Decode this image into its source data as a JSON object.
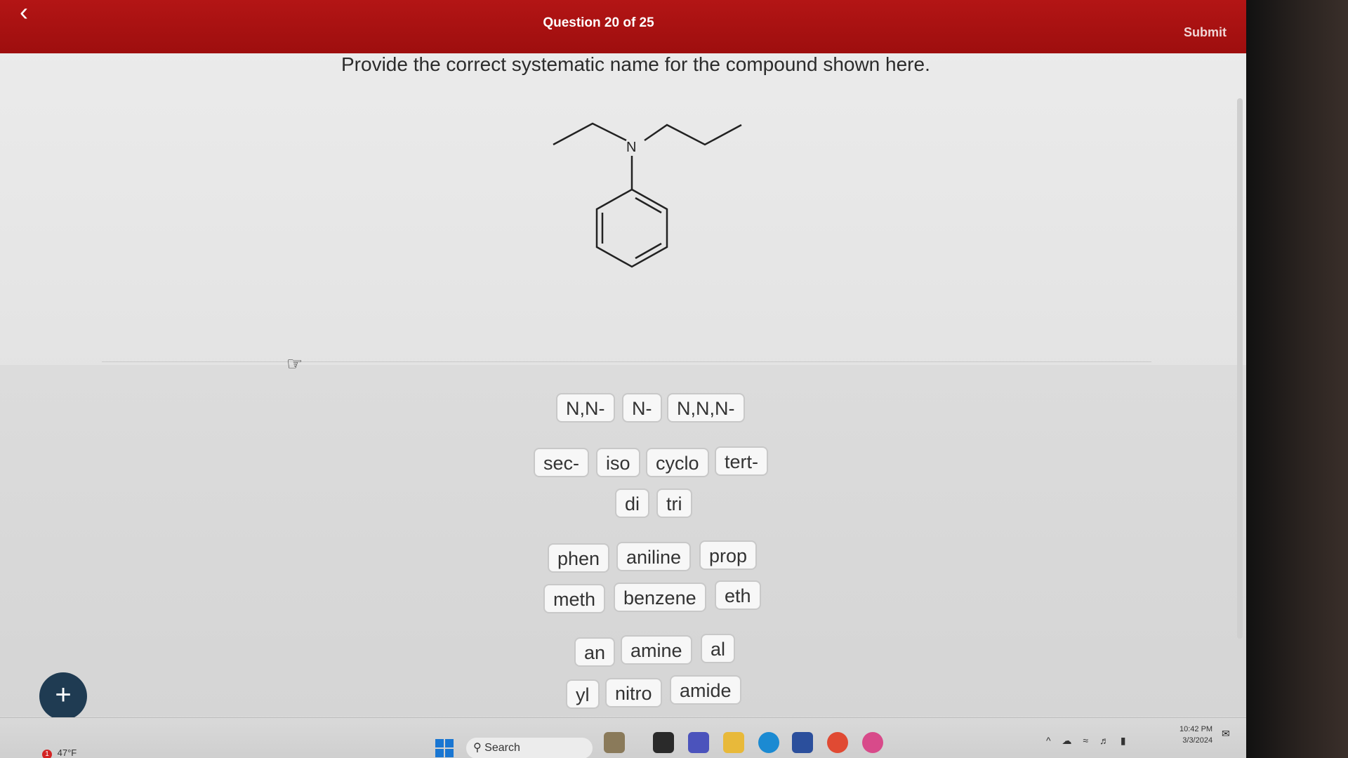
{
  "header": {
    "back_icon": "chevron-left-icon",
    "question_counter": "Question 20 of 25",
    "submit_label": "Submit",
    "accent_color": "#b31515"
  },
  "question": {
    "prompt": "Provide the correct systematic name for the compound shown here.",
    "molecule_atom_label": "N"
  },
  "word_bank": {
    "row1": [
      "N,N-",
      "N-",
      "N,N,N-"
    ],
    "row2": [
      "sec-",
      "iso",
      "cyclo",
      "tert-"
    ],
    "row3": [
      "di",
      "tri"
    ],
    "row4": [
      "phen",
      "aniline",
      "prop"
    ],
    "row5": [
      "meth",
      "benzene",
      "eth"
    ],
    "row6": [
      "an",
      "amine",
      "al"
    ],
    "row7": [
      "yl",
      "nitro",
      "amide"
    ]
  },
  "fab": {
    "icon": "plus-icon",
    "label": "+"
  },
  "taskbar": {
    "weather_alert": "1",
    "weather_temp": "47°F",
    "search_label": "Search",
    "time": "10:42 PM",
    "date": "3/3/2024"
  }
}
